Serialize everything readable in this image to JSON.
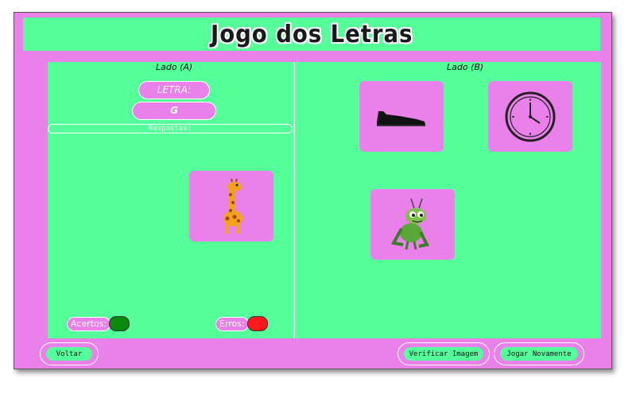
{
  "title": "Jogo dos Letras",
  "left_side": {
    "label": "Lado (A)",
    "letra_label": "LETRA:",
    "letra_value": "G",
    "respostas_label": "Respostas:",
    "answer_card": "giraffe-image",
    "acertos_label": "Acertos:",
    "erros_label": "Erros:"
  },
  "right_side": {
    "label": "Lado (B)",
    "cards": [
      "shoe-image",
      "clock-image",
      "grasshopper-image"
    ]
  },
  "buttons": {
    "voltar": "Voltar",
    "verificar": "Verificar Imagem",
    "jogar": "Jogar Novamente"
  },
  "colors": {
    "background": "#ea80ea",
    "panel": "#55ff99",
    "acertos": "#0a8a0a",
    "erros": "#ff1a1a"
  }
}
